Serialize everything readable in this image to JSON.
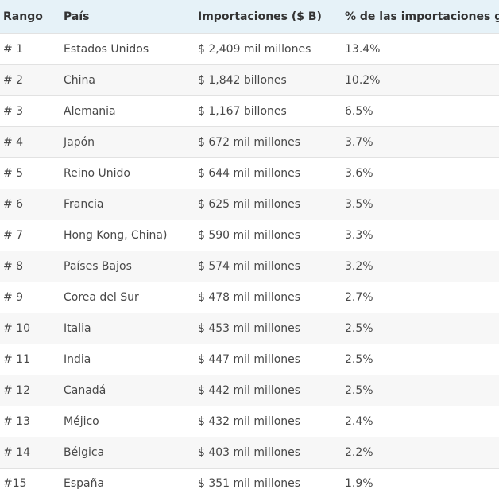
{
  "table": {
    "headers": [
      "Rango",
      "País",
      "Importaciones ($ B)",
      "% de las importaciones globales"
    ],
    "rows": [
      [
        "# 1",
        "Estados Unidos",
        "$ 2,409 mil millones",
        "13.4%"
      ],
      [
        "# 2",
        "China",
        "$ 1,842 billones",
        "10.2%"
      ],
      [
        "# 3",
        "Alemania",
        "$ 1,167 billones",
        "6.5%"
      ],
      [
        "# 4",
        "Japón",
        "$ 672 mil millones",
        "3.7%"
      ],
      [
        "# 5",
        "Reino Unido",
        "$ 644 mil millones",
        "3.6%"
      ],
      [
        "# 6",
        "Francia",
        "$ 625 mil millones",
        "3.5%"
      ],
      [
        "# 7",
        "Hong Kong, China)",
        "$ 590 mil millones",
        "3.3%"
      ],
      [
        "# 8",
        "Países Bajos",
        "$ 574 mil millones",
        "3.2%"
      ],
      [
        "# 9",
        "Corea del Sur",
        "$ 478 mil millones",
        "2.7%"
      ],
      [
        "# 10",
        "Italia",
        "$ 453 mil millones",
        "2.5%"
      ],
      [
        "# 11",
        "India",
        "$ 447 mil millones",
        "2.5%"
      ],
      [
        "# 12",
        "Canadá",
        "$ 442 mil millones",
        "2.5%"
      ],
      [
        "# 13",
        "Méjico",
        "$ 432 mil millones",
        "2.4%"
      ],
      [
        "# 14",
        "Bélgica",
        "$ 403 mil millones",
        "2.2%"
      ],
      [
        "#15",
        "España",
        "$ 351 mil millones",
        "1.9%"
      ]
    ]
  },
  "colors": {
    "header_background": "#e6f2f8",
    "row_alt_background": "#f7f7f7",
    "row_border": "#e2e2e2",
    "text": "#484848"
  }
}
